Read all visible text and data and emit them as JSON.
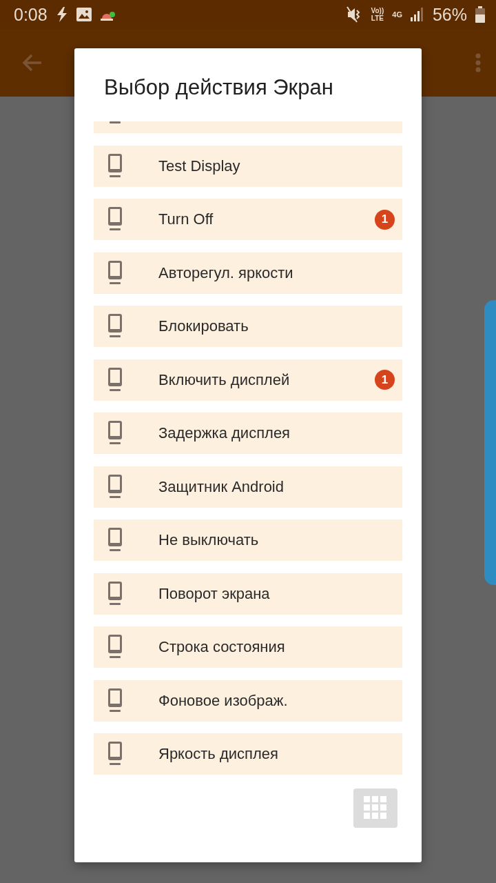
{
  "status_bar": {
    "time": "0:08",
    "volte_top": "Vo))",
    "volte_bottom": "LTE",
    "network": "4G",
    "battery": "56%"
  },
  "dialog": {
    "title": "Выбор действия Экран",
    "items": [
      {
        "label": "Test Display"
      },
      {
        "label": "Turn Off",
        "badge": "1"
      },
      {
        "label": "Авторегул. яркости"
      },
      {
        "label": "Блокировать"
      },
      {
        "label": "Включить дисплей",
        "badge": "1"
      },
      {
        "label": "Задержка дисплея"
      },
      {
        "label": "Защитник Android"
      },
      {
        "label": "Не выключать"
      },
      {
        "label": "Поворот экрана"
      },
      {
        "label": "Строка состояния"
      },
      {
        "label": "Фоновое изображ."
      },
      {
        "label": "Яркость дисплея"
      }
    ]
  }
}
